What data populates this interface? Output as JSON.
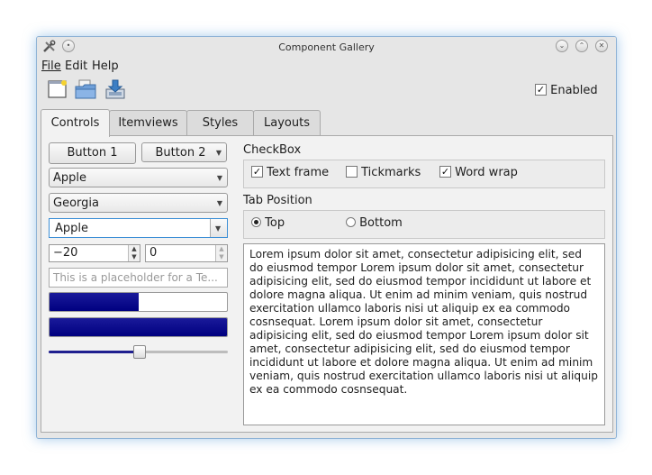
{
  "window": {
    "title": "Component Gallery"
  },
  "menu": {
    "file": "File",
    "edit": "Edit",
    "help": "Help"
  },
  "toolbar": {
    "enabled_label": "Enabled",
    "enabled_checked": true
  },
  "tabs": [
    "Controls",
    "Itemviews",
    "Styles",
    "Layouts"
  ],
  "controls": {
    "button1": "Button 1",
    "button2": "Button 2",
    "combo1": "Apple",
    "combo_font": "Georgia",
    "combo_edit": "Apple",
    "spin1": "−20",
    "spin2": "0",
    "placeholder": "This is a placeholder for a Te...",
    "progress1_fraction": 0.5,
    "progress2_fraction": 1.0,
    "slider_fraction": 0.5
  },
  "checkbox_group": {
    "title": "CheckBox",
    "items": [
      {
        "label": "Text frame",
        "checked": true
      },
      {
        "label": "Tickmarks",
        "checked": false
      },
      {
        "label": "Word wrap",
        "checked": true
      }
    ]
  },
  "tab_position": {
    "title": "Tab Position",
    "items": [
      {
        "label": "Top",
        "selected": true
      },
      {
        "label": "Bottom",
        "selected": false
      }
    ]
  },
  "textedit": {
    "content": "Lorem ipsum dolor sit amet, consectetur adipisicing elit, sed do eiusmod tempor Lorem ipsum dolor sit amet, consectetur adipisicing elit, sed do eiusmod tempor incididunt ut labore et dolore magna aliqua. Ut enim ad minim veniam, quis nostrud exercitation ullamco laboris nisi ut aliquip ex ea commodo cosnsequat. Lorem ipsum dolor sit amet, consectetur adipisicing elit, sed do eiusmod tempor Lorem ipsum dolor sit amet, consectetur adipisicing elit, sed do eiusmod tempor incididunt ut labore et dolore magna aliqua. Ut enim ad minim veniam, quis nostrud exercitation ullamco laboris nisi ut aliquip ex ea commodo cosnsequat."
  },
  "icons": {
    "app": "app-tools-icon",
    "new": "new-document-icon",
    "open": "open-folder-icon",
    "save": "save-download-icon"
  }
}
